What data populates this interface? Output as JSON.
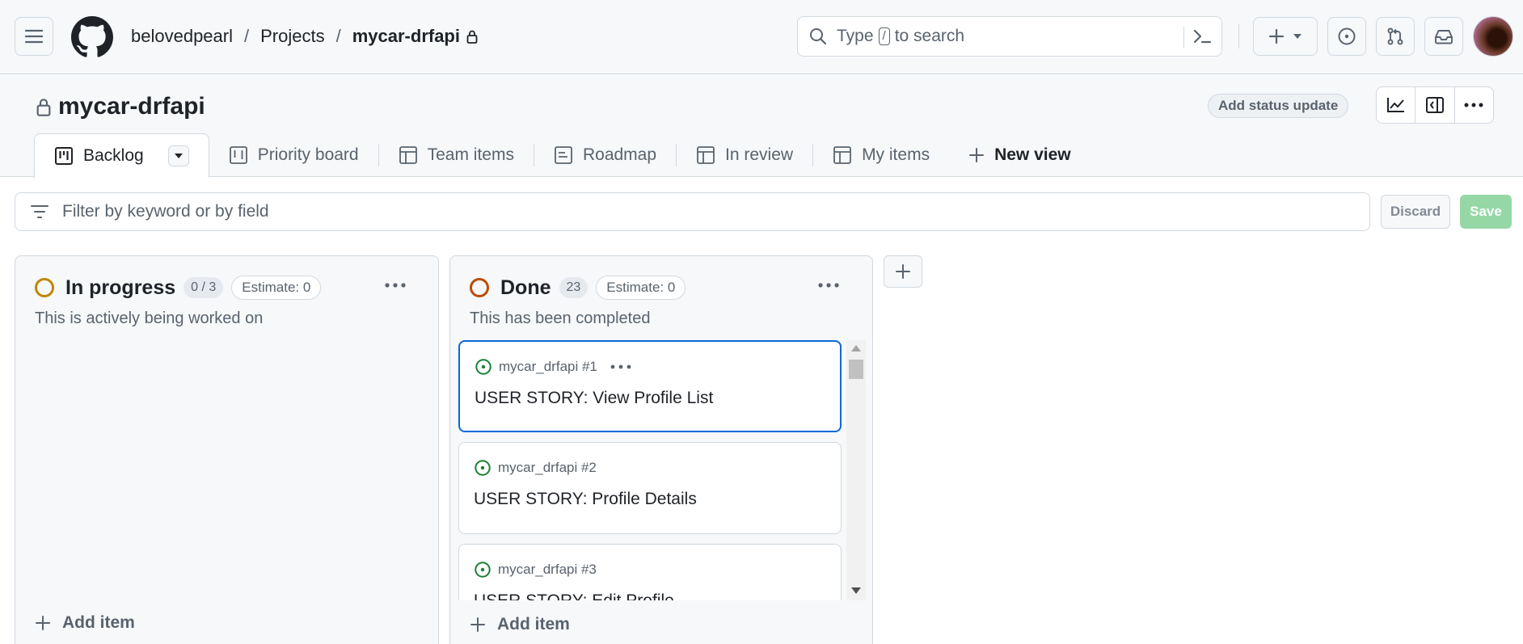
{
  "breadcrumb": {
    "owner": "belovedpearl",
    "section": "Projects",
    "repo": "mycar-drfapi",
    "separator": "/"
  },
  "search": {
    "prefix": "Type",
    "key": "/",
    "suffix": "to search"
  },
  "project": {
    "title": "mycar-drfapi",
    "status_update_label": "Add status update"
  },
  "tabs": [
    {
      "label": "Backlog",
      "icon": "board-icon"
    },
    {
      "label": "Priority board",
      "icon": "board-icon"
    },
    {
      "label": "Team items",
      "icon": "table-icon"
    },
    {
      "label": "Roadmap",
      "icon": "roadmap-icon"
    },
    {
      "label": "In review",
      "icon": "table-icon"
    },
    {
      "label": "My items",
      "icon": "table-icon"
    }
  ],
  "new_view_label": "New view",
  "filter": {
    "placeholder": "Filter by keyword or by field",
    "discard_label": "Discard",
    "save_label": "Save"
  },
  "columns": [
    {
      "name": "In progress",
      "count": "0 / 3",
      "estimate": "Estimate: 0",
      "description": "This is actively being worked on",
      "ring_color": "#bf8700",
      "add_item_label": "Add item",
      "cards": []
    },
    {
      "name": "Done",
      "count": "23",
      "estimate": "Estimate: 0",
      "description": "This has been completed",
      "ring_color": "#bc4c00",
      "add_item_label": "Add item",
      "cards": [
        {
          "ref": "mycar_drfapi #1",
          "title": "USER STORY: View Profile List",
          "selected": true
        },
        {
          "ref": "mycar_drfapi #2",
          "title": "USER STORY: Profile Details",
          "selected": false
        },
        {
          "ref": "mycar_drfapi #3",
          "title": "USER STORY: Edit Profile",
          "selected": false
        }
      ]
    }
  ],
  "colors": {
    "accent": "#0969da",
    "issue_open": "#1a7f37",
    "save_disabled": "#95d8a6"
  }
}
